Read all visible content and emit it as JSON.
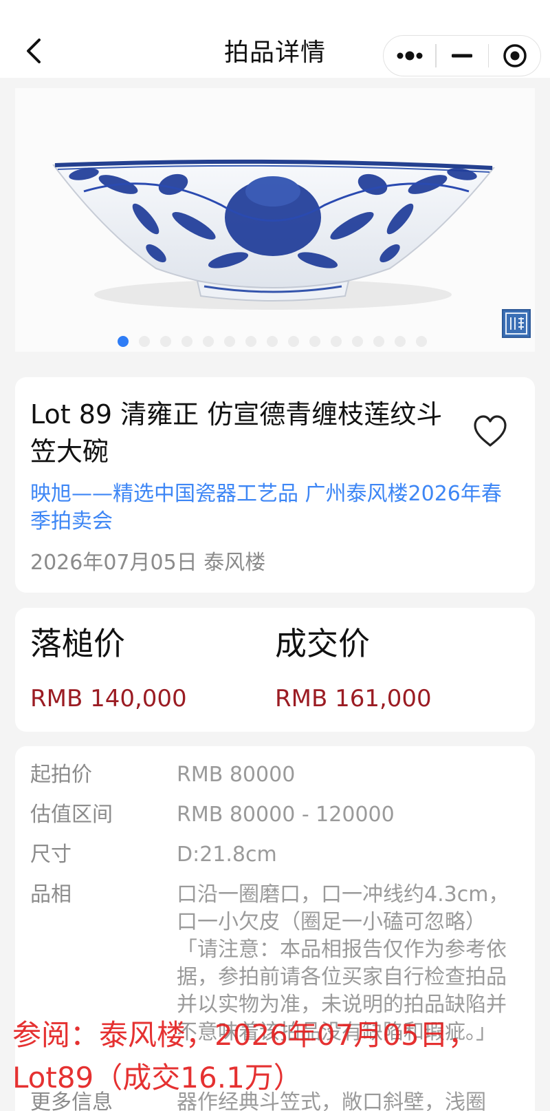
{
  "navbar": {
    "title": "拍品详情"
  },
  "gallery": {
    "image_count": 15,
    "active_index": 0,
    "seal_text": "泰风楼"
  },
  "lot": {
    "title": "Lot 89 清雍正  仿宣德青缠枝莲纹斗笠大碗",
    "auction_name": "映旭——精选中国瓷器工艺品 广州泰风楼2026年春季拍卖会",
    "date_location": "2026年07月05日 泰风楼"
  },
  "prices": {
    "hammer_label": "落槌价",
    "hammer_value": "RMB 140,000",
    "final_label": "成交价",
    "final_value": "RMB 161,000"
  },
  "details": [
    {
      "label": "起拍价",
      "value": "RMB 80000"
    },
    {
      "label": "估值区间",
      "value": "RMB 80000 - 120000"
    },
    {
      "label": "尺寸",
      "value": "D:21.8cm"
    },
    {
      "label": "品相",
      "value": "口沿一圈磨口，口一冲线约4.3cm，口一小欠皮（圈足一小磕可忽略）「请注意：本品相报告仅作为参考依据，参拍前请各位买家自行检查拍品并以实物为准，未说明的拍品缺陷并不意味着该拍品没有缺陷和瑕疵。」"
    },
    {
      "label": "更多信息",
      "value": "器作经典斗笠式，敞口斜壁，浅圈"
    }
  ],
  "watermark": {
    "line1": "参阅：泰风楼，2026年07月05日，",
    "line2": "Lot89（成交16.1万）"
  },
  "colors": {
    "accent_blue": "#3d86f5",
    "price_red": "#9b1c23",
    "watermark_red": "#e21b1b",
    "dot_active": "#2f7df6"
  }
}
